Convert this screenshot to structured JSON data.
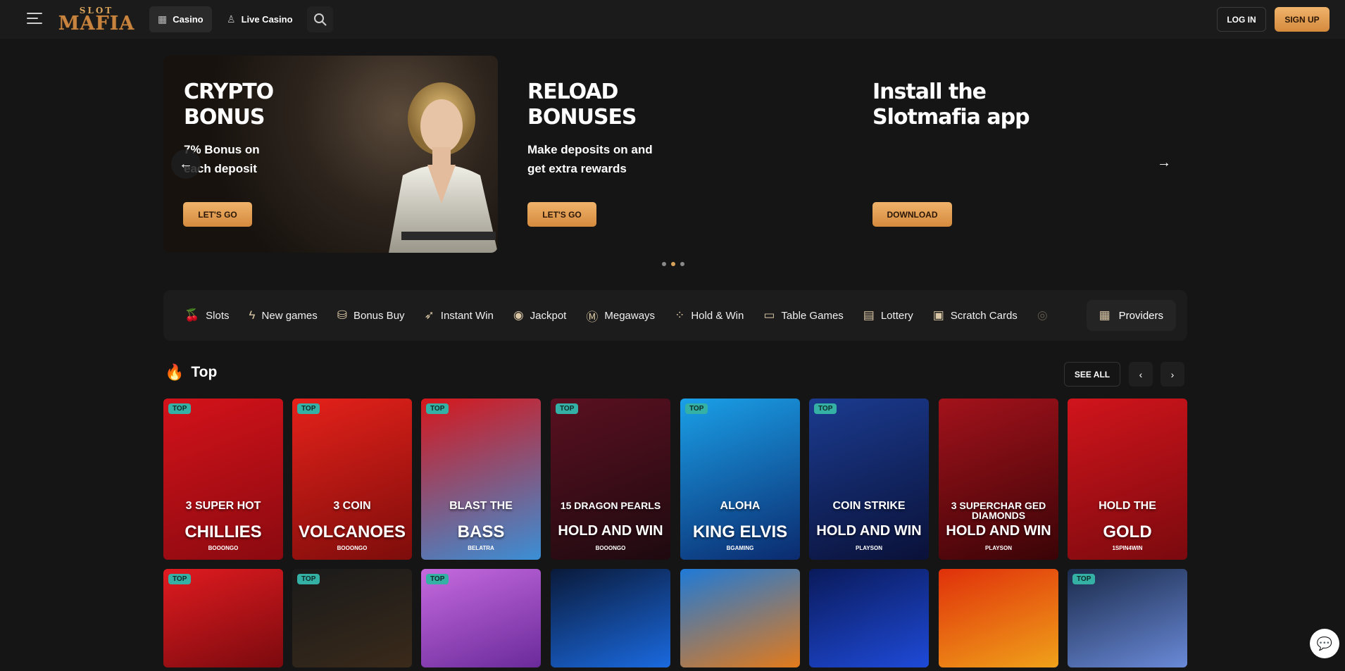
{
  "header": {
    "logo_top": "SLOT",
    "logo_main": "MAFIA",
    "tabs": [
      {
        "label": "Casino",
        "icon": "slot-icon"
      },
      {
        "label": "Live Casino",
        "icon": "dealer-icon"
      }
    ],
    "login_label": "LOG IN",
    "signup_label": "SIGN UP"
  },
  "banners": [
    {
      "title_line1": "CRYPTO",
      "title_line2": "BONUS",
      "sub_line1": "7% Bonus on",
      "sub_line2": "each deposit",
      "button": "LET'S GO"
    },
    {
      "title_line1": "RELOAD",
      "title_line2": "BONUSES",
      "sub_line1": "Make deposits on and",
      "sub_line2": "get extra rewards",
      "button": "LET'S GO"
    },
    {
      "title_line1": "Install the",
      "title_line2": "Slotmafia app",
      "sub_line1": "",
      "sub_line2": "",
      "button": "DOWNLOAD"
    }
  ],
  "categories": [
    {
      "label": "Slots",
      "icon": "cherry-icon"
    },
    {
      "label": "New games",
      "icon": "lightning-icon"
    },
    {
      "label": "Bonus Buy",
      "icon": "bag-icon"
    },
    {
      "label": "Instant Win",
      "icon": "rocket-icon"
    },
    {
      "label": "Jackpot",
      "icon": "coin-bag-icon"
    },
    {
      "label": "Megaways",
      "icon": "m-icon"
    },
    {
      "label": "Hold & Win",
      "icon": "grid-dots-icon"
    },
    {
      "label": "Table Games",
      "icon": "cards-icon"
    },
    {
      "label": "Lottery",
      "icon": "ticket-icon"
    },
    {
      "label": "Scratch Cards",
      "icon": "scratch-icon"
    }
  ],
  "providers_label": "Providers",
  "section": {
    "title": "Top",
    "see_all": "SEE ALL"
  },
  "games_row1": [
    {
      "tag": "TOP",
      "title1": "3 SUPER HOT",
      "title2": "CHILLIES",
      "provider": "BOOONGO",
      "bg1": "#d4121a",
      "bg2": "#8a0a10"
    },
    {
      "tag": "TOP",
      "title1": "3 COIN",
      "title2": "VOLCANOES",
      "provider": "BOOONGO",
      "bg1": "#e5211a",
      "bg2": "#7d0d0b"
    },
    {
      "tag": "TOP",
      "title1": "BLAST THE",
      "title2": "BASS",
      "provider": "BELATRA",
      "bg1": "#d7171b",
      "bg2": "#3a8fd6"
    },
    {
      "tag": "TOP",
      "title1": "15 DRAGON PEARLS",
      "title2": "HOLD AND WIN",
      "provider": "BOOONGO",
      "bg1": "#5a1020",
      "bg2": "#1e0a10"
    },
    {
      "tag": "TOP",
      "title1": "ALOHA",
      "title2": "KING ELVIS",
      "provider": "BGAMING",
      "bg1": "#1aa0e8",
      "bg2": "#0b2a6e"
    },
    {
      "tag": "TOP",
      "title1": "COIN STRIKE",
      "title2": "HOLD AND WIN",
      "provider": "PLAYSON",
      "bg1": "#1b3b8f",
      "bg2": "#0a1138"
    },
    {
      "tag": "",
      "title1": "3 SUPERCHAR GED DIAMONDS",
      "title2": "HOLD AND WIN",
      "provider": "PLAYSON",
      "bg1": "#a3121b",
      "bg2": "#3a0407"
    },
    {
      "tag": "",
      "title1": "HOLD THE",
      "title2": "GOLD",
      "provider": "1SPIN4WIN",
      "bg1": "#d1141c",
      "bg2": "#7a0a0e"
    }
  ],
  "games_row2": [
    {
      "tag": "TOP",
      "bg1": "#e01b20",
      "bg2": "#7a0a0e"
    },
    {
      "tag": "TOP",
      "bg1": "#1a1a1a",
      "bg2": "#3a2a1a"
    },
    {
      "tag": "TOP",
      "bg1": "#c56adf",
      "bg2": "#6a2a9a"
    },
    {
      "tag": "",
      "bg1": "#0a1a3a",
      "bg2": "#1a6ae0"
    },
    {
      "tag": "",
      "bg1": "#1e7ad8",
      "bg2": "#e37a1a"
    },
    {
      "tag": "",
      "bg1": "#0a1a5a",
      "bg2": "#1e4ad8"
    },
    {
      "tag": "",
      "bg1": "#e0300a",
      "bg2": "#f0a21a"
    },
    {
      "tag": "TOP",
      "bg1": "#1a2a4a",
      "bg2": "#6a8ad8"
    }
  ],
  "colors": {
    "accent": "#d9a25a",
    "background": "#151515",
    "tag": "#35b0a5"
  }
}
